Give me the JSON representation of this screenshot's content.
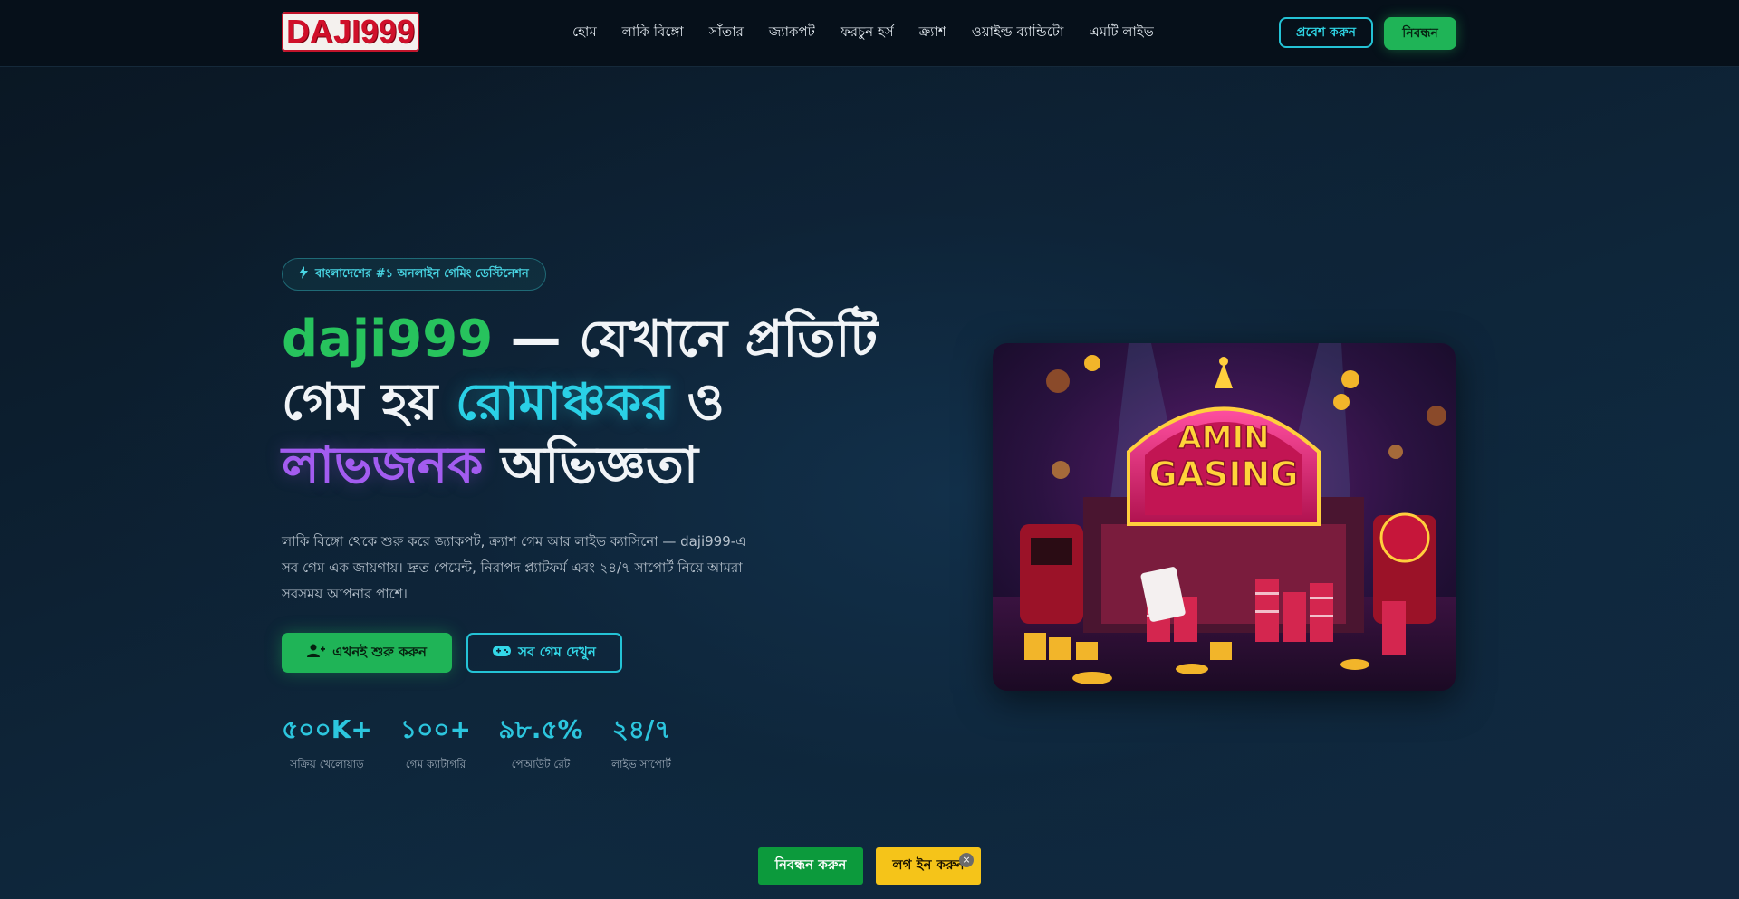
{
  "header": {
    "logo_text": "DAJI999",
    "nav": [
      "হোম",
      "লাকি বিঙ্গো",
      "সাঁতার",
      "জ্যাকপট",
      "ফরচুন হর্স",
      "ক্র্যাশ",
      "ওয়াইল্ড ব্যান্ডিটো",
      "এমটি লাইভ"
    ],
    "login_label": "প্রবেশ করুন",
    "register_label": "নিবন্ধন"
  },
  "hero": {
    "badge_icon": "bolt-icon",
    "badge_text": "বাংলাদেশের #১ অনলাইন গেমিং ডেস্টিনেশন",
    "headline": {
      "brand": "daji999",
      "part1": " — যেখানে প্রতিটি গেম হয় ",
      "word_thrilling": "রোমাঞ্চকর",
      "part2": " ও ",
      "word_profitable": "লাভজনক",
      "part3": " অভিজ্ঞতা"
    },
    "description": "লাকি বিঙ্গো থেকে শুরু করে জ্যাকপট, ক্র্যাশ গেম আর লাইভ ক্যাসিনো — daji999-এ সব গেম এক জায়গায়। দ্রুত পেমেন্ট, নিরাপদ প্ল্যাটফর্ম এবং ২৪/৭ সাপোর্ট নিয়ে আমরা সবসময় আপনার পাশে।",
    "cta_primary": "এখনই শুরু করুন",
    "cta_primary_icon": "user-plus-icon",
    "cta_secondary": "সব গেম দেখুন",
    "cta_secondary_icon": "gamepad-icon",
    "stats": [
      {
        "value": "৫০০K+",
        "label": "সক্রিয় খেলোয়াড়"
      },
      {
        "value": "১০০+",
        "label": "গেম ক্যাটাগরি"
      },
      {
        "value": "৯৮.৫%",
        "label": "পেআউট রেট"
      },
      {
        "value": "২৪/৭",
        "label": "লাইভ সাপোর্ট"
      }
    ],
    "image_sign_line1": "AMIN",
    "image_sign_line2": "GASING"
  },
  "bottom_bar": {
    "register_label": "নিবন্ধন করুন",
    "login_label": "লগ ইন করুন",
    "close_symbol": "×"
  },
  "colors": {
    "accent_green": "#1fb457",
    "accent_cyan": "#2ad0e6",
    "accent_purple": "#a35cf0",
    "bottom_login_yellow": "#f5c419"
  }
}
